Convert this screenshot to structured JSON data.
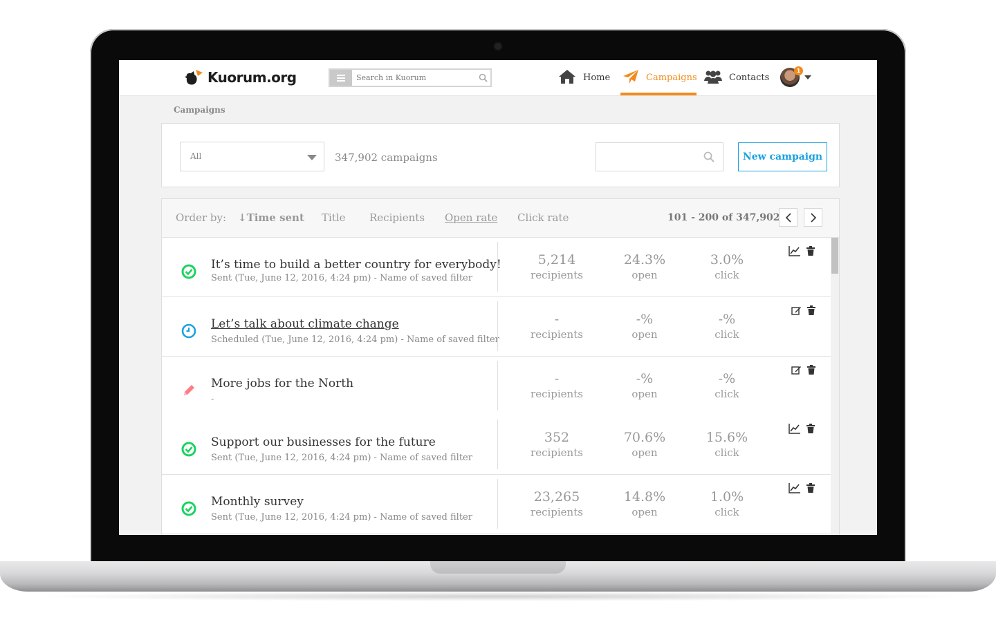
{
  "app": {
    "logo_text": "Kuorum.org"
  },
  "topbar": {
    "search_placeholder": "Search in Kuorum",
    "nav": [
      {
        "label": "Home",
        "icon": "home-icon"
      },
      {
        "label": "Campaigns",
        "icon": "paper-plane-icon",
        "active": true
      },
      {
        "label": "Contacts",
        "icon": "users-icon"
      }
    ],
    "notification_count": "1",
    "accent_color": "#f28b1d"
  },
  "breadcrumb": "Campaigns",
  "filter": {
    "selected": "All",
    "count_text": "347,902 campaigns",
    "new_button": "New campaign"
  },
  "order": {
    "label": "Order by:",
    "options": [
      "↓Time sent",
      "Title",
      "Recipients",
      "Open rate",
      "Click rate"
    ],
    "pager_text": "101 - 200 of 347,902"
  },
  "metric_labels": {
    "recipients": "recipients",
    "open": "open",
    "click": "click"
  },
  "campaigns": [
    {
      "status": "sent",
      "title": "It’s time to build a better country for everybody!",
      "subtitle": "Sent (Tue, June 12, 2016, 4:24 pm) - Name of saved filter",
      "recipients": "5,214",
      "open": "24.3%",
      "click": "3.0%",
      "action": "stats-icon"
    },
    {
      "status": "scheduled",
      "title": "Let’s talk about climate change",
      "subtitle": "Scheduled (Tue, June 12, 2016, 4:24 pm) - Name of saved filter",
      "recipients": "-",
      "open": "-%",
      "click": "-%",
      "action": "edit-icon"
    },
    {
      "status": "draft",
      "title": "More jobs for the North",
      "subtitle": "-",
      "recipients": "-",
      "open": "-%",
      "click": "-%",
      "action": "edit-icon"
    },
    {
      "status": "sent",
      "title": "Support our businesses for the future",
      "subtitle": "Sent (Tue, June 12, 2016, 4:24 pm) - Name of saved filter",
      "recipients": "352",
      "open": "70.6%",
      "click": "15.6%",
      "action": "stats-icon"
    },
    {
      "status": "sent",
      "title": "Monthly survey",
      "subtitle": "Sent (Tue, June 12, 2016, 4:24 pm) - Name of saved filter",
      "recipients": "23,265",
      "open": "14.8%",
      "click": "1.0%",
      "action": "stats-icon"
    }
  ]
}
